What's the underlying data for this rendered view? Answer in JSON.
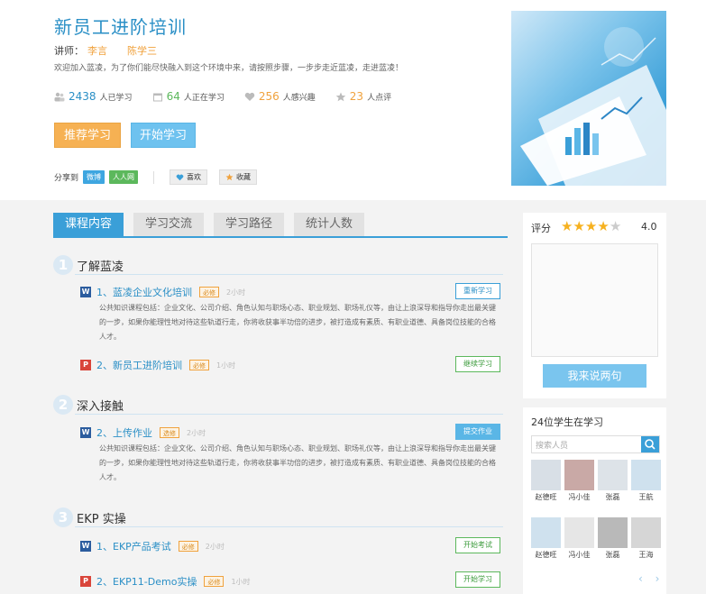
{
  "course": {
    "title": "新员工进阶培训",
    "lecturer_label": "讲师：",
    "lecturers": [
      "李言",
      "陈学三"
    ],
    "welcome": "欢迎加入蓝凌，为了你们能尽快融入到这个环境中来，请按照步骤，一步步走近蓝凌，走进蓝凌！",
    "stats": [
      {
        "icon": "people-icon",
        "num": "2438",
        "label": "人已学习"
      },
      {
        "icon": "calendar-icon",
        "num": "64",
        "label": "人正在学习"
      },
      {
        "icon": "heart-icon",
        "num": "256",
        "label": "人感兴趣"
      },
      {
        "icon": "star-icon",
        "num": "23",
        "label": "人点评"
      }
    ],
    "stat_colors": [
      "#2a8fc6",
      "#5cb85c",
      "#f0a23d",
      "#f0a23d"
    ],
    "recommend_label": "推荐学习",
    "start_label": "开始学习",
    "share_label": "分享到",
    "share_weibo": "微博",
    "share_renren": "人人网",
    "like_label": "喜欢",
    "fav_label": "收藏"
  },
  "tabs": [
    "课程内容",
    "学习交流",
    "学习路径",
    "统计人数"
  ],
  "sections": [
    {
      "num": "1",
      "title": "了解蓝凌",
      "lessons": [
        {
          "type": "W",
          "name": "1、蓝凌企业文化培训",
          "tag": "必修",
          "duration": "2小时",
          "button": "重新学习",
          "desc": "公共知识课程包括：企业文化、公司介绍、角色认知与职场心态、职业规划、职场礼仪等，由让上浪深导和指导你走出最关键的一步，如果你能理性地对待这些轨道行走，你将收获事半功倍的进步，被打造成有素质、有职业道德、具备岗位技能的合格人才。"
        },
        {
          "type": "P",
          "name": "2、新员工进阶培训",
          "tag": "必修",
          "duration": "1小时",
          "button": "继续学习",
          "desc": ""
        }
      ]
    },
    {
      "num": "2",
      "title": "深入接触",
      "lessons": [
        {
          "type": "W",
          "name": "2、上传作业",
          "tag": "选修",
          "duration": "2小时",
          "button": "提交作业",
          "desc": "公共知识课程包括：企业文化、公司介绍、角色认知与职场心态、职业规划、职场礼仪等，由让上浪深导和指导你走出最关键的一步，如果你能理性地对待这些轨道行走，你将收获事半功倍的进步，被打造成有素质、有职业道德、具备岗位技能的合格人才。"
        }
      ]
    },
    {
      "num": "3",
      "title": "EKP 实操",
      "lessons": [
        {
          "type": "W",
          "name": "1、EKP产品考试",
          "tag": "必修",
          "duration": "2小时",
          "button": "开始考试",
          "desc": ""
        },
        {
          "type": "P",
          "name": "2、EKP11-Demo实操",
          "tag": "必修",
          "duration": "1小时",
          "button": "开始学习",
          "desc": ""
        }
      ]
    }
  ],
  "rating": {
    "label": "评分",
    "value": "4.0",
    "stars_filled": 4,
    "stars_total": 5,
    "button": "我来说两句"
  },
  "learners": {
    "title": "24位学生在学习",
    "search_placeholder": "搜索人员",
    "people": [
      "赵德旺",
      "冯小佳",
      "张磊",
      "王航",
      "赵德旺",
      "冯小佳",
      "张磊",
      "王海"
    ],
    "pager": "‹ ›"
  }
}
